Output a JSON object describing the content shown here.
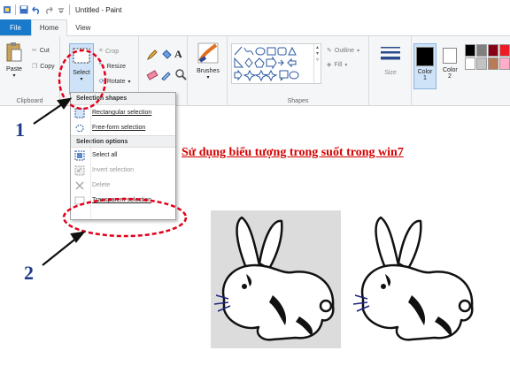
{
  "window": {
    "title": "Untitled - Paint"
  },
  "tabs": [
    {
      "label": "File"
    },
    {
      "label": "Home"
    },
    {
      "label": "View"
    }
  ],
  "clipboard": {
    "paste": "Paste",
    "cut": "Cut",
    "copy": "Copy",
    "group": "Clipboard"
  },
  "image": {
    "select": "Select",
    "crop": "Crop",
    "resize": "Resize",
    "rotate": "Rotate"
  },
  "tools": {
    "brushes": "Brushes"
  },
  "shapes": {
    "outline": "Outline",
    "fill": "Fill",
    "group": "Shapes"
  },
  "size": {
    "label": "Size"
  },
  "colors": {
    "color1": "Color 1",
    "color2": "Color 2",
    "palette": [
      "#000000",
      "#7f7f7f",
      "#880015",
      "#ed1c24",
      "#ffffff",
      "#c3c3c3",
      "#b97a57",
      "#ffaec9"
    ]
  },
  "select_menu": {
    "section_shapes": "Selection shapes",
    "rect": "Rectangular selection",
    "freeform": "Free-form selection",
    "section_options": "Selection options",
    "select_all": "Select all",
    "invert": "Invert selection",
    "delete": "Delete",
    "transparent": "Transparent selection"
  },
  "annotations": {
    "step1": "1",
    "step2": "2",
    "heading": "Sử dụng biểu tượng trong suốt trong win7",
    "accent": "#d40000"
  }
}
